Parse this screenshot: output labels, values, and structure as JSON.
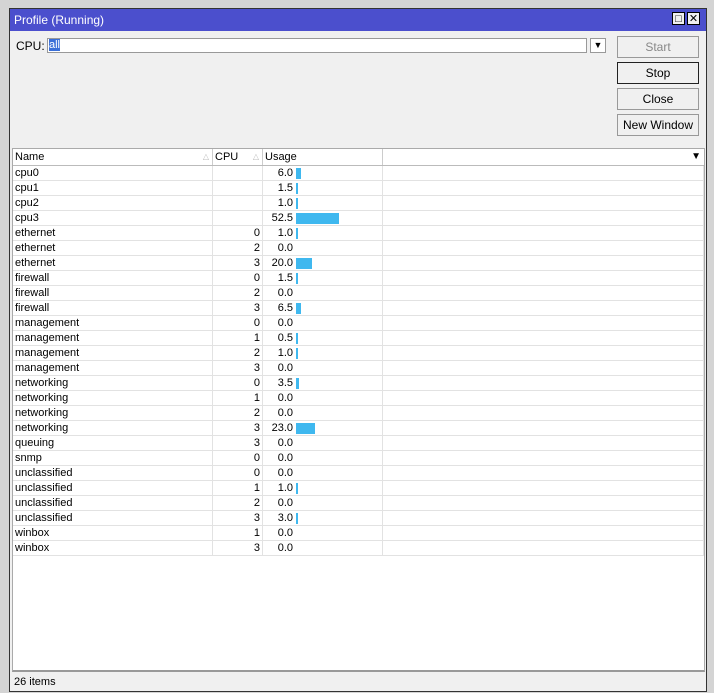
{
  "window": {
    "title": "Profile (Running)",
    "maximize_icon": "maximize-icon",
    "close_icon": "close-icon"
  },
  "cpu_filter": {
    "label": "CPU:",
    "value": "all"
  },
  "buttons": {
    "start": "Start",
    "stop": "Stop",
    "close": "Close",
    "new_window": "New Window"
  },
  "columns": [
    "Name",
    "CPU",
    "Usage"
  ],
  "colors": {
    "title_bar": "#4b4fcd",
    "usage_bar": "#3fb8ef"
  },
  "rows": [
    {
      "name": "cpu0",
      "cpu": "",
      "usage": "6.0"
    },
    {
      "name": "cpu1",
      "cpu": "",
      "usage": "1.5"
    },
    {
      "name": "cpu2",
      "cpu": "",
      "usage": "1.0"
    },
    {
      "name": "cpu3",
      "cpu": "",
      "usage": "52.5"
    },
    {
      "name": "ethernet",
      "cpu": "0",
      "usage": "1.0"
    },
    {
      "name": "ethernet",
      "cpu": "2",
      "usage": "0.0"
    },
    {
      "name": "ethernet",
      "cpu": "3",
      "usage": "20.0"
    },
    {
      "name": "firewall",
      "cpu": "0",
      "usage": "1.5"
    },
    {
      "name": "firewall",
      "cpu": "2",
      "usage": "0.0"
    },
    {
      "name": "firewall",
      "cpu": "3",
      "usage": "6.5"
    },
    {
      "name": "management",
      "cpu": "0",
      "usage": "0.0"
    },
    {
      "name": "management",
      "cpu": "1",
      "usage": "0.5"
    },
    {
      "name": "management",
      "cpu": "2",
      "usage": "1.0"
    },
    {
      "name": "management",
      "cpu": "3",
      "usage": "0.0"
    },
    {
      "name": "networking",
      "cpu": "0",
      "usage": "3.5"
    },
    {
      "name": "networking",
      "cpu": "1",
      "usage": "0.0"
    },
    {
      "name": "networking",
      "cpu": "2",
      "usage": "0.0"
    },
    {
      "name": "networking",
      "cpu": "3",
      "usage": "23.0"
    },
    {
      "name": "queuing",
      "cpu": "3",
      "usage": "0.0"
    },
    {
      "name": "snmp",
      "cpu": "0",
      "usage": "0.0"
    },
    {
      "name": "unclassified",
      "cpu": "0",
      "usage": "0.0"
    },
    {
      "name": "unclassified",
      "cpu": "1",
      "usage": "1.0"
    },
    {
      "name": "unclassified",
      "cpu": "2",
      "usage": "0.0"
    },
    {
      "name": "unclassified",
      "cpu": "3",
      "usage": "3.0"
    },
    {
      "name": "winbox",
      "cpu": "1",
      "usage": "0.0"
    },
    {
      "name": "winbox",
      "cpu": "3",
      "usage": "0.0"
    }
  ],
  "status": "26 items"
}
